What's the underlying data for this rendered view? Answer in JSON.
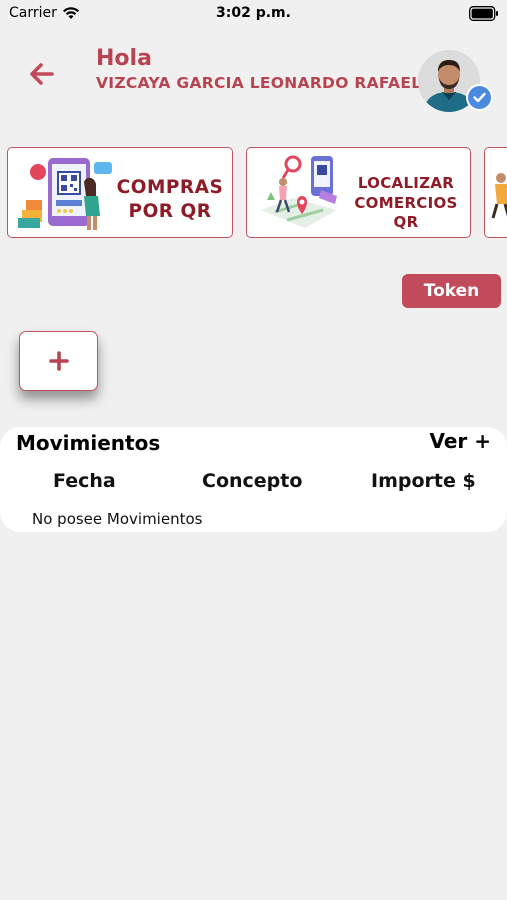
{
  "status_bar": {
    "carrier": "Carrier",
    "time": "3:02 p.m."
  },
  "header": {
    "greeting": "Hola",
    "user_name": "VIZCAYA GARCIA LEONARDO RAFAEL"
  },
  "banners": [
    {
      "line1": "COMPRAS",
      "line2": "POR QR"
    },
    {
      "line1": "LOCALIZAR",
      "line2": "COMERCIOS QR"
    }
  ],
  "token_button": "Token",
  "add_button": "+",
  "movements": {
    "title": "Movimientos",
    "see_more": "Ver +",
    "columns": [
      "Fecha",
      "Concepto",
      "Importe $"
    ],
    "empty_message": "No posee Movimientos"
  },
  "colors": {
    "accent": "#b84452",
    "banner_text": "#8e1b26",
    "background": "#f0f0f0"
  },
  "icons": [
    "wifi-icon",
    "battery-icon",
    "back-arrow-icon",
    "verified-check-icon",
    "plus-icon"
  ]
}
